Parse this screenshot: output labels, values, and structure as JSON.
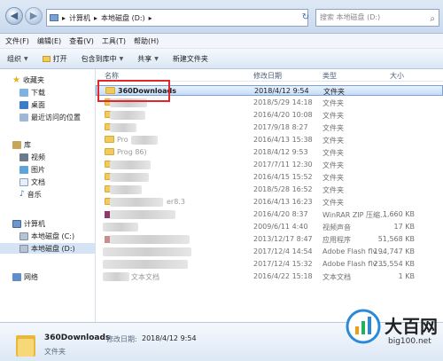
{
  "address": {
    "path": [
      "计算机",
      "本地磁盘 (D:)"
    ],
    "search_placeholder": "搜索 本地磁盘 (D:)"
  },
  "menu": [
    "文件(F)",
    "编辑(E)",
    "查看(V)",
    "工具(T)",
    "帮助(H)"
  ],
  "toolbar": {
    "organize": "组织",
    "open": "打开",
    "include": "包含到库中",
    "share": "共享",
    "new_folder": "新建文件夹"
  },
  "nav": {
    "favorites": "收藏夹",
    "downloads": "下载",
    "desktop": "桌面",
    "recent": "最近访问的位置",
    "library": "库",
    "videos": "视频",
    "pictures": "图片",
    "documents": "文档",
    "music": "音乐",
    "computer": "计算机",
    "drive_c": "本地磁盘 (C:)",
    "drive_d": "本地磁盘 (D:)",
    "network": "网络"
  },
  "columns": {
    "name": "名称",
    "date": "修改日期",
    "type": "类型",
    "size": "大小"
  },
  "files": [
    {
      "name": "360Downloads",
      "date": "2018/4/12 9:54",
      "type": "文件夹",
      "size": ""
    },
    {
      "name": "",
      "date": "2018/5/29 14:18",
      "type": "文件夹",
      "size": ""
    },
    {
      "name": "",
      "date": "2016/4/20 10:08",
      "type": "文件夹",
      "size": ""
    },
    {
      "name": "",
      "date": "2017/9/18 8:27",
      "type": "文件夹",
      "size": ""
    },
    {
      "name": "Pro",
      "date": "2016/4/13 15:38",
      "type": "文件夹",
      "size": ""
    },
    {
      "name": "Prog 86)",
      "date": "2018/4/12 9:53",
      "type": "文件夹",
      "size": ""
    },
    {
      "name": "",
      "date": "2017/7/11 12:30",
      "type": "文件夹",
      "size": ""
    },
    {
      "name": "",
      "date": "2016/4/15 15:52",
      "type": "文件夹",
      "size": ""
    },
    {
      "name": "",
      "date": "2018/5/28 16:52",
      "type": "文件夹",
      "size": ""
    },
    {
      "name": "er8.3",
      "date": "2016/4/13 16:23",
      "type": "文件夹",
      "size": ""
    },
    {
      "name": "",
      "date": "2016/4/20 8:37",
      "type": "WinRAR ZIP 压缩...",
      "size": "1,660 KB"
    },
    {
      "name": "",
      "date": "2009/6/11 4:40",
      "type": "视频声音",
      "size": "17 KB"
    },
    {
      "name": "",
      "date": "2013/12/17 8:47",
      "type": "应用程序",
      "size": "51,568 KB"
    },
    {
      "name": "",
      "date": "2017/12/4 14:54",
      "type": "Adobe Flash flv ...",
      "size": "194,747 KB"
    },
    {
      "name": "",
      "date": "2017/12/4 15:32",
      "type": "Adobe Flash flv ...",
      "size": "235,554 KB"
    },
    {
      "name": "文本文档",
      "date": "2016/4/22 15:18",
      "type": "文本文档",
      "size": "1 KB"
    }
  ],
  "details": {
    "name": "360Downloads",
    "date_label": "修改日期:",
    "date": "2018/4/12 9:54",
    "type": "文件夹"
  },
  "watermark": {
    "text": "大百网",
    "url": "big100.net"
  },
  "colors": {
    "selection": "#cce0f7",
    "highlight_box": "#e0282a",
    "folder": "#f1cc5a"
  }
}
